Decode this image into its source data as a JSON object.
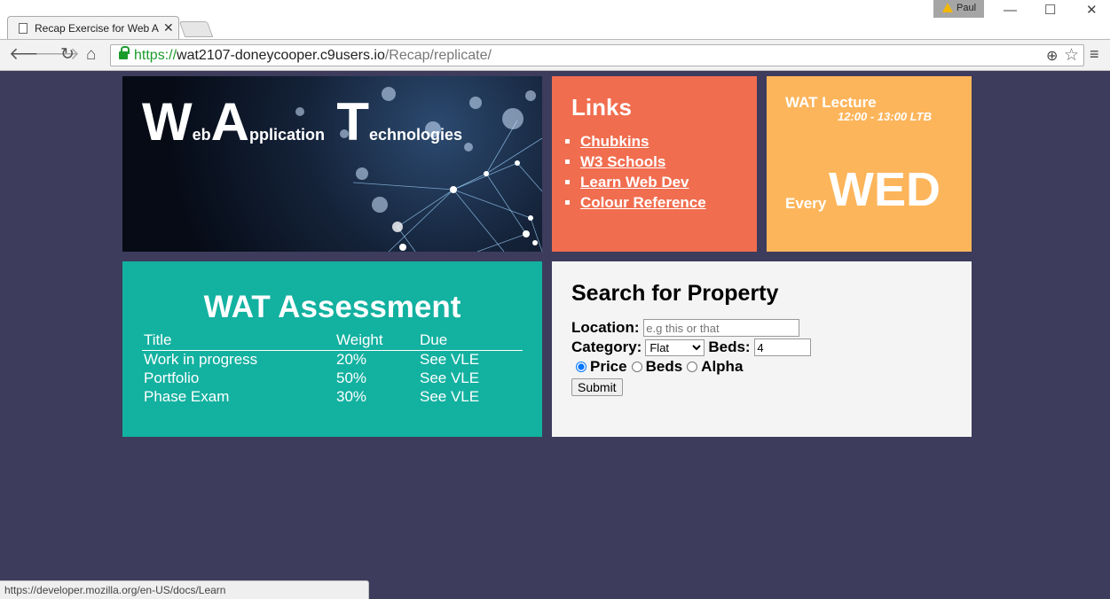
{
  "browser": {
    "tab_title": "Recap Exercise for Web Ap",
    "profile_name": "Paul",
    "url_scheme": "https://",
    "url_host": "wat2107-doneycooper.c9users.io",
    "url_path": "/Recap/replicate/",
    "status_url": "https://developer.mozilla.org/en-US/docs/Learn",
    "icons": [
      "back-icon",
      "forward-icon",
      "reload-icon",
      "home-icon",
      "lock-icon",
      "zoom-icon",
      "star-icon",
      "menu-icon"
    ]
  },
  "banner": {
    "w": "W",
    "w_rest": "eb",
    "a": "A",
    "a_rest": "pplication",
    "t": "T",
    "t_rest": "echnologies"
  },
  "links": {
    "title": "Links",
    "items": [
      "Chubkins",
      "W3 Schools",
      "Learn Web Dev",
      "Colour Reference"
    ]
  },
  "lecture": {
    "title": "WAT Lecture",
    "time": "12:00 - 13:00 LTB",
    "every": "Every",
    "day": "WED"
  },
  "assessment": {
    "title": "WAT Assessment",
    "headers": [
      "Title",
      "Weight",
      "Due"
    ],
    "rows": [
      [
        "Work in progress",
        "20%",
        "See VLE"
      ],
      [
        "Portfolio",
        "50%",
        "See VLE"
      ],
      [
        "Phase Exam",
        "30%",
        "See VLE"
      ]
    ]
  },
  "search": {
    "title": "Search for Property",
    "location_label": "Location:",
    "location_placeholder": "e.g this or that",
    "category_label": "Category:",
    "category_value": "Flat",
    "beds_label": "Beds:",
    "beds_value": "4",
    "sort_options": [
      "Price",
      "Beds",
      "Alpha"
    ],
    "sort_selected": "Price",
    "submit_label": "Submit"
  },
  "colors": {
    "page_bg": "#3d3c5c",
    "links_bg": "#f16d4f",
    "lecture_bg": "#fdb55b",
    "assessment_bg": "#13b1a0",
    "search_bg": "#f4f4f4"
  }
}
